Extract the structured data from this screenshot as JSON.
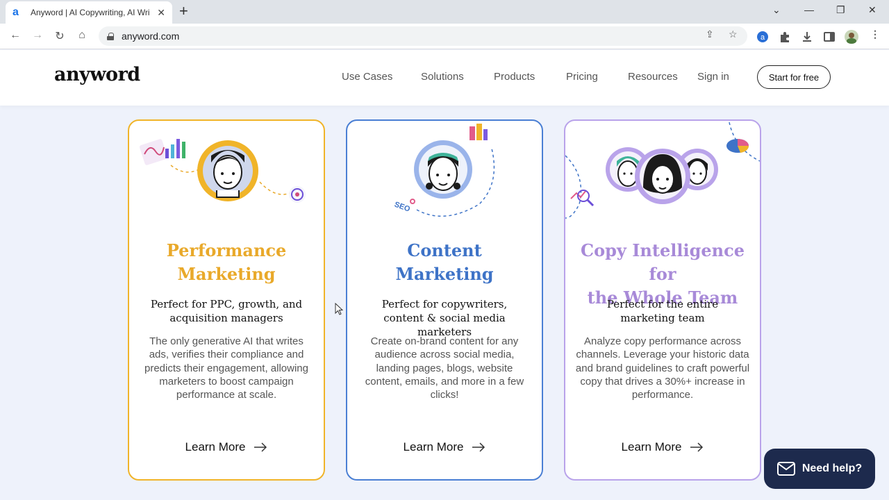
{
  "browser": {
    "tab_title": "Anyword | AI Copywriting, AI Wri",
    "tab_favicon": "a",
    "url": "anyword.com",
    "icons": [
      "back-icon",
      "forward-icon",
      "reload-icon",
      "home-icon",
      "lock-icon",
      "share-icon",
      "star-icon",
      "extension-icon",
      "puzzle-icon",
      "download-icon",
      "sidepanel-icon",
      "profile-icon",
      "menu-icon"
    ]
  },
  "header": {
    "logo": "anyword",
    "nav": [
      "Use Cases",
      "Solutions",
      "Products",
      "Pricing",
      "Resources",
      "Sign in"
    ],
    "cta": "Start for free"
  },
  "cards": [
    {
      "title_line1": "Performance",
      "title_line2": "Marketing",
      "subtitle": "Perfect for PPC, growth, and acquisition managers",
      "body": "The only generative AI that writes ads, verifies their compliance and predicts their engagement, allowing marketers to boost campaign performance at scale.",
      "link": "Learn More",
      "accent": "#f0b429"
    },
    {
      "title_line1": "Content",
      "title_line2": "Marketing",
      "subtitle": "Perfect for copywriters, content & social media marketers",
      "body": "Create on-brand content for any audience across social media, landing pages, blogs, website content, emails, and more in a few clicks!",
      "link": "Learn More",
      "illus_label": "SEO",
      "accent": "#4a7fd4"
    },
    {
      "title_line1": "Copy Intelligence for",
      "title_line2": "the Whole Team",
      "subtitle": "Perfect for the entire marketing team",
      "body": "Analyze copy performance across channels. Leverage your historic data and brand guidelines to craft powerful copy that drives a 30%+ increase in performance.",
      "link": "Learn More",
      "accent": "#b9a3ea"
    }
  ],
  "help": {
    "label": "Need help?"
  }
}
